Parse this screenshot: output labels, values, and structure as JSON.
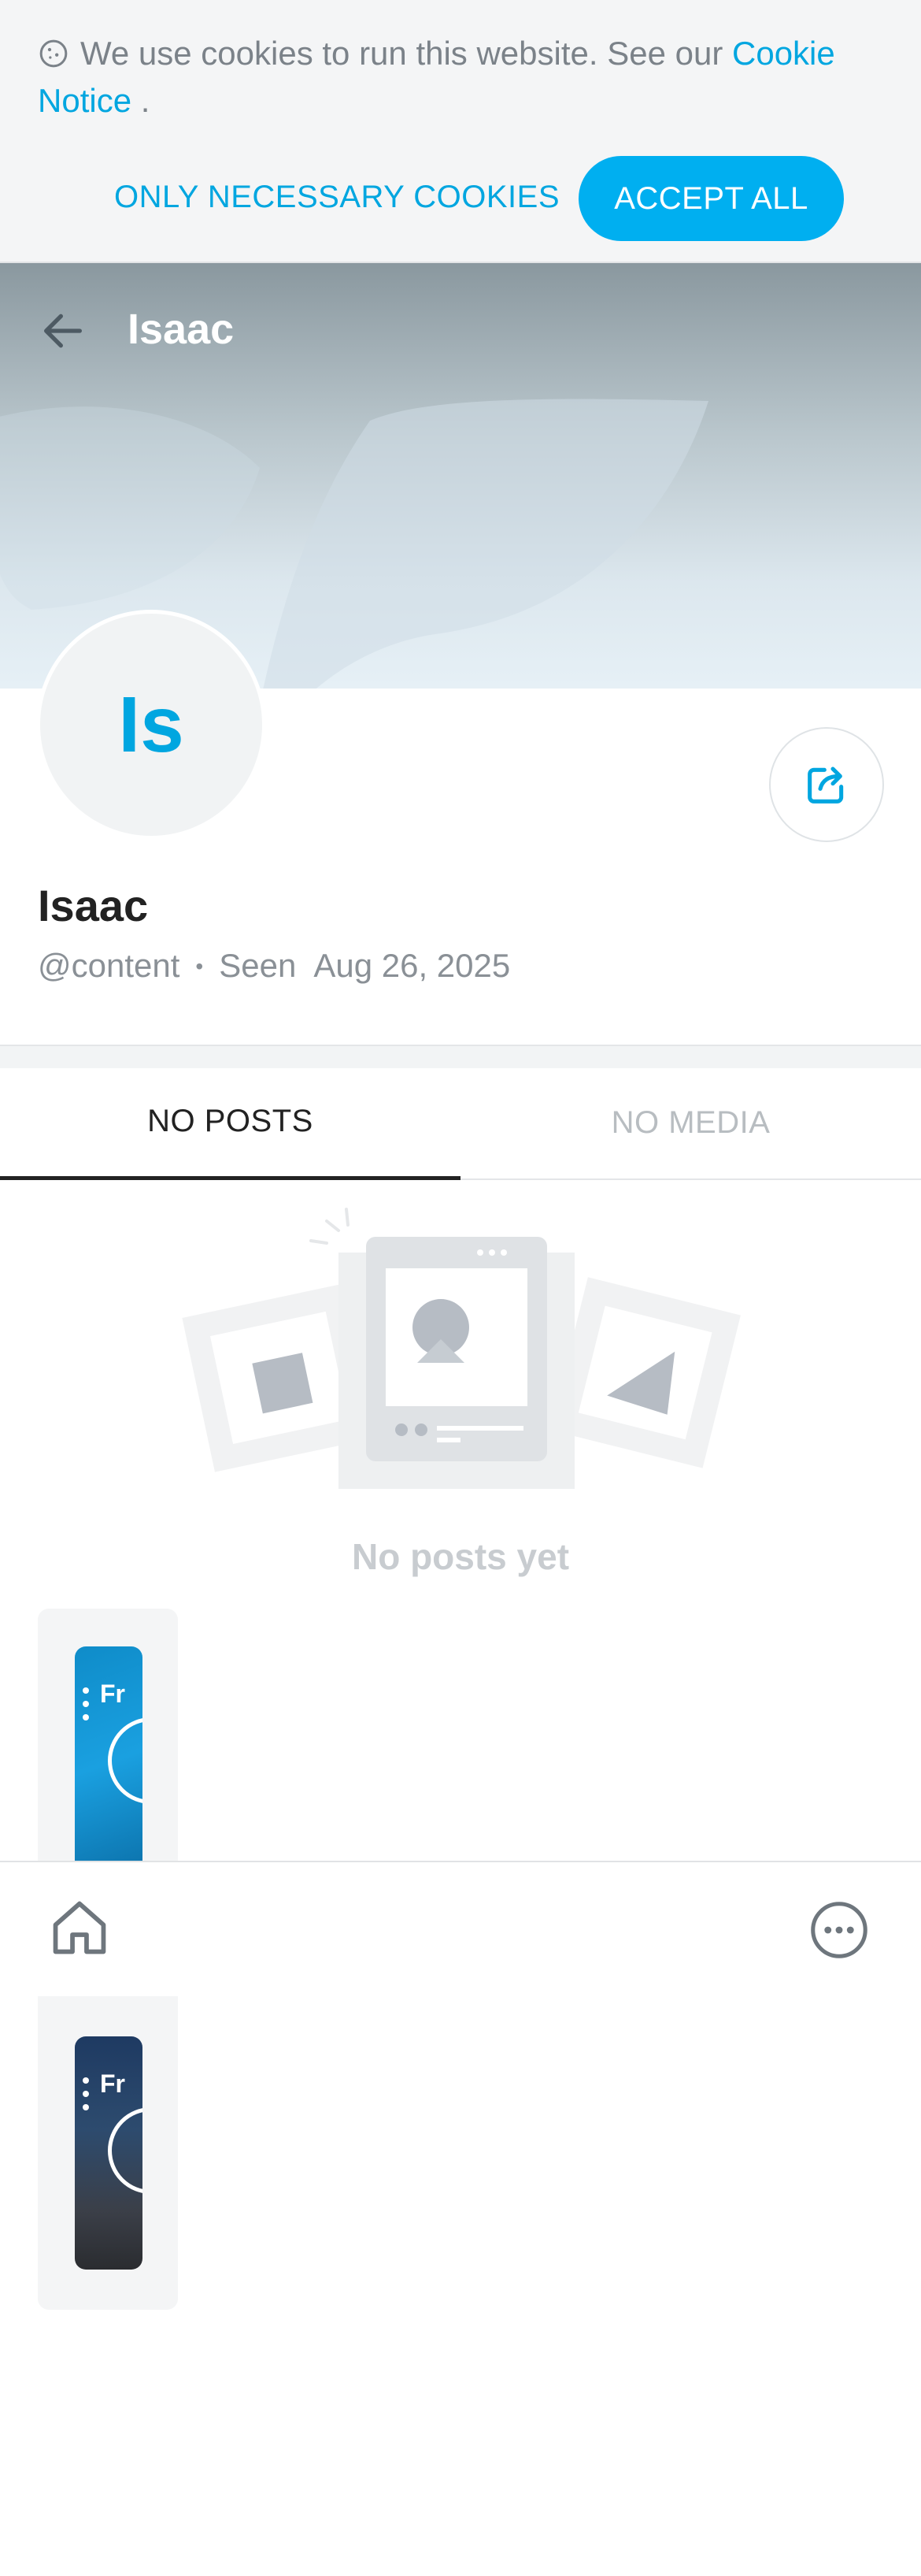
{
  "cookie_banner": {
    "text": "We use cookies to run this website. See our",
    "link_text": "Cookie Notice",
    "link_suffix": " .",
    "necessary_label": "ONLY NECESSARY COOKIES",
    "accept_label": "ACCEPT ALL",
    "icon": "cookie-icon"
  },
  "header": {
    "title": "Isaac",
    "back_icon": "arrow-left-icon"
  },
  "profile": {
    "initials": "Is",
    "name": "Isaac",
    "username": "@content",
    "separator": "•",
    "seen_label": "Seen",
    "seen_date": "Aug 26, 2025",
    "share_icon": "share-icon"
  },
  "tabs": [
    {
      "label": "NO POSTS",
      "active": true
    },
    {
      "label": "NO MEDIA",
      "active": false
    }
  ],
  "empty_state": {
    "text": "No posts yet"
  },
  "cards": [
    {
      "label": "Fr"
    },
    {
      "label": "Fr"
    }
  ],
  "bottom_nav": {
    "home_icon": "home-icon",
    "more_icon": "more-icon"
  },
  "colors": {
    "accent": "#00aff0",
    "link": "#00a6e0",
    "text": "#222222",
    "muted": "#8a9096"
  }
}
